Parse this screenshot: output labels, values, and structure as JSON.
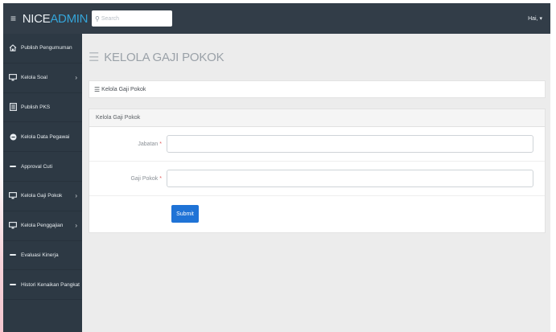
{
  "header": {
    "menu_icon": "≡",
    "brand_part1": "NICE",
    "brand_part2": "ADMIN",
    "search_placeholder": "Search",
    "user_label": "Hai, ▾"
  },
  "sidebar": {
    "items": [
      {
        "label": "Publish Pengumuman",
        "icon": "home-icon",
        "has_arrow": false
      },
      {
        "label": "Kelola Soal",
        "icon": "monitor-icon",
        "has_arrow": true
      },
      {
        "label": "Publish PKS",
        "icon": "document-icon",
        "has_arrow": false
      },
      {
        "label": "Kelola Data Pegawai",
        "icon": "circle-icon",
        "has_arrow": false
      },
      {
        "label": "Approval Cuti",
        "icon": "dash-icon",
        "has_arrow": false
      },
      {
        "label": "Kelola Gaji Pokok",
        "icon": "monitor-icon",
        "has_arrow": true
      },
      {
        "label": "Kelola Penggajian",
        "icon": "monitor-icon",
        "has_arrow": true
      },
      {
        "label": "Evaluasi Kinerja",
        "icon": "dash-icon",
        "has_arrow": false
      },
      {
        "label": "Histori Kenaikan Pangkat",
        "icon": "dash-icon",
        "has_arrow": false
      }
    ]
  },
  "main": {
    "page_title": "KELOLA GAJI POKOK",
    "breadcrumb": "Kelola Gaji Pokok",
    "panel_title": "Kelola Gaji Pokok",
    "fields": [
      {
        "label": "Jabatan",
        "required_mark": "*",
        "value": ""
      },
      {
        "label": "Gaji Pokok",
        "required_mark": "*",
        "value": ""
      }
    ],
    "submit_label": "Submit"
  }
}
